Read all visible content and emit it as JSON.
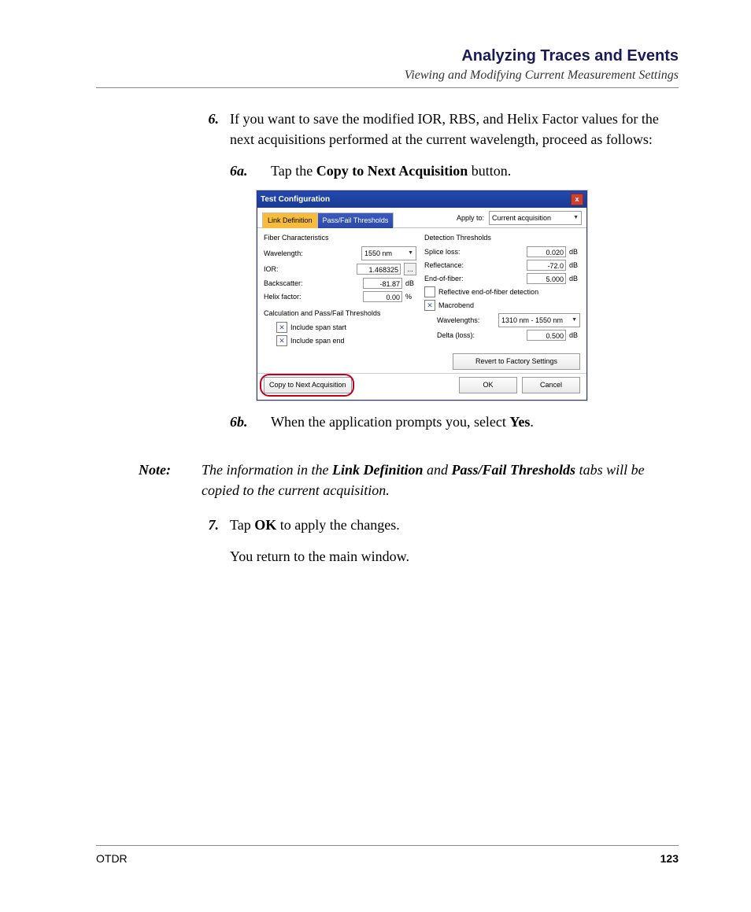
{
  "header": {
    "title": "Analyzing Traces and Events",
    "subtitle": "Viewing and Modifying Current Measurement Settings"
  },
  "step6": {
    "num": "6.",
    "text_a": "If you want to save the modified IOR, RBS, and Helix Factor values for the next acquisitions performed at the current wavelength, proceed as follows:",
    "sub_a": {
      "num": "6a.",
      "pre": "Tap the ",
      "bold": "Copy to Next Acquisition",
      "post": " button."
    },
    "sub_b": {
      "num": "6b.",
      "pre": "When the application prompts you, select ",
      "bold": "Yes",
      "post": "."
    }
  },
  "note": {
    "label": "Note:",
    "p1": "The information in the ",
    "b1": "Link Definition",
    "p2": " and ",
    "b2": "Pass/Fail Thresholds",
    "p3": " tabs will be copied to the current acquisition."
  },
  "step7": {
    "num": "7.",
    "pre": "Tap ",
    "bold": "OK",
    "post": " to apply the changes.",
    "after": "You return to the main window."
  },
  "footer": {
    "left": "OTDR",
    "right": "123"
  },
  "dialog": {
    "title": "Test Configuration",
    "close_x": "x",
    "tabs": {
      "link_def": "Link Definition",
      "passfail": "Pass/Fail Thresholds"
    },
    "applyto_label": "Apply to:",
    "applyto_value": "Current acquisition",
    "fiber": {
      "group": "Fiber Characteristics",
      "wavelength_label": "Wavelength:",
      "wavelength_value": "1550 nm",
      "ior_label": "IOR:",
      "ior_value": "1.468325",
      "ior_ell": "...",
      "back_label": "Backscatter:",
      "back_value": "-81.87",
      "back_unit": "dB",
      "helix_label": "Helix factor:",
      "helix_value": "0.00",
      "helix_unit": "%"
    },
    "calc": {
      "group": "Calculation and Pass/Fail Thresholds",
      "span_start": "Include span start",
      "span_end": "Include span end",
      "check_mark": "✕"
    },
    "det": {
      "group": "Detection Thresholds",
      "splice_label": "Splice loss:",
      "splice_value": "0.020",
      "splice_unit": "dB",
      "refl_label": "Reflectance:",
      "refl_value": "-72.0",
      "refl_unit": "dB",
      "eof_label": "End-of-fiber:",
      "eof_value": "5.000",
      "eof_unit": "dB",
      "reof": "Reflective end-of-fiber detection",
      "macro": "Macrobend",
      "wl_label": "Wavelengths:",
      "wl_value": "1310 nm - 1550 nm",
      "delta_label": "Delta (loss):",
      "delta_value": "0.500",
      "delta_unit": "dB"
    },
    "revert": "Revert to Factory Settings",
    "copy_next": "Copy to Next Acquisition",
    "ok": "OK",
    "cancel": "Cancel"
  }
}
